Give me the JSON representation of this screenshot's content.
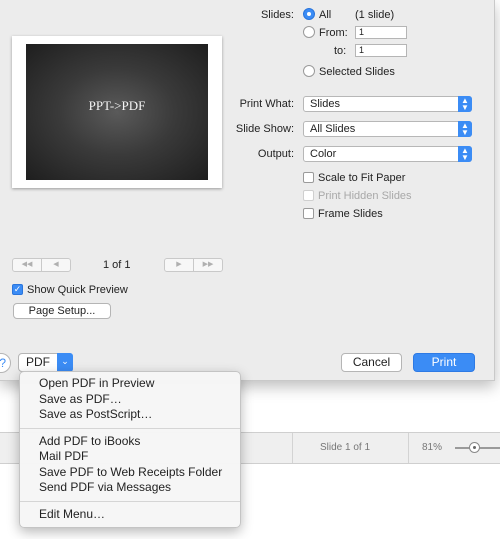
{
  "print_dialog": {
    "preview": {
      "slide_title": "PPT->PDF",
      "page_indicator": "1 of 1",
      "nav_first": "◀◀",
      "nav_prev": "◀",
      "nav_next": "▶",
      "nav_last": "▶▶",
      "show_quick_preview_label": "Show Quick Preview",
      "show_quick_preview_checked": true,
      "page_setup_label": "Page Setup..."
    },
    "slides": {
      "label": "Slides:",
      "all_label": "All",
      "all_count": "(1 slide)",
      "from_label": "From:",
      "from_value": "1",
      "to_label": "to:",
      "to_value": "1",
      "selected_label": "Selected Slides",
      "selected_option": "All"
    },
    "print_what": {
      "label": "Print What:",
      "value": "Slides"
    },
    "slide_show": {
      "label": "Slide Show:",
      "value": "All Slides"
    },
    "output": {
      "label": "Output:",
      "value": "Color"
    },
    "options": [
      {
        "label": "Scale to Fit Paper",
        "checked": false,
        "enabled": true
      },
      {
        "label": "Print Hidden Slides",
        "checked": false,
        "enabled": false
      },
      {
        "label": "Frame Slides",
        "checked": false,
        "enabled": true
      }
    ],
    "footer": {
      "help_label": "?",
      "pdf_label": "PDF",
      "cancel_label": "Cancel",
      "print_label": "Print"
    }
  },
  "pdf_menu": {
    "group1": [
      "Open PDF in Preview",
      "Save as PDF…",
      "Save as PostScript…"
    ],
    "group2": [
      "Add PDF to iBooks",
      "Mail PDF",
      "Save PDF to Web Receipts Folder",
      "Send PDF via Messages"
    ],
    "group3": [
      "Edit Menu…"
    ]
  },
  "status_bar": {
    "slide_info": "Slide 1 of 1",
    "zoom": "81%"
  },
  "colors": {
    "accent": "#3b8cf5",
    "dialog_bg": "#ececec"
  },
  "icons": {
    "popup_arrows": "up-down-arrows-icon",
    "pdf_chevron": "chevron-down-icon",
    "help": "question-mark-icon"
  }
}
